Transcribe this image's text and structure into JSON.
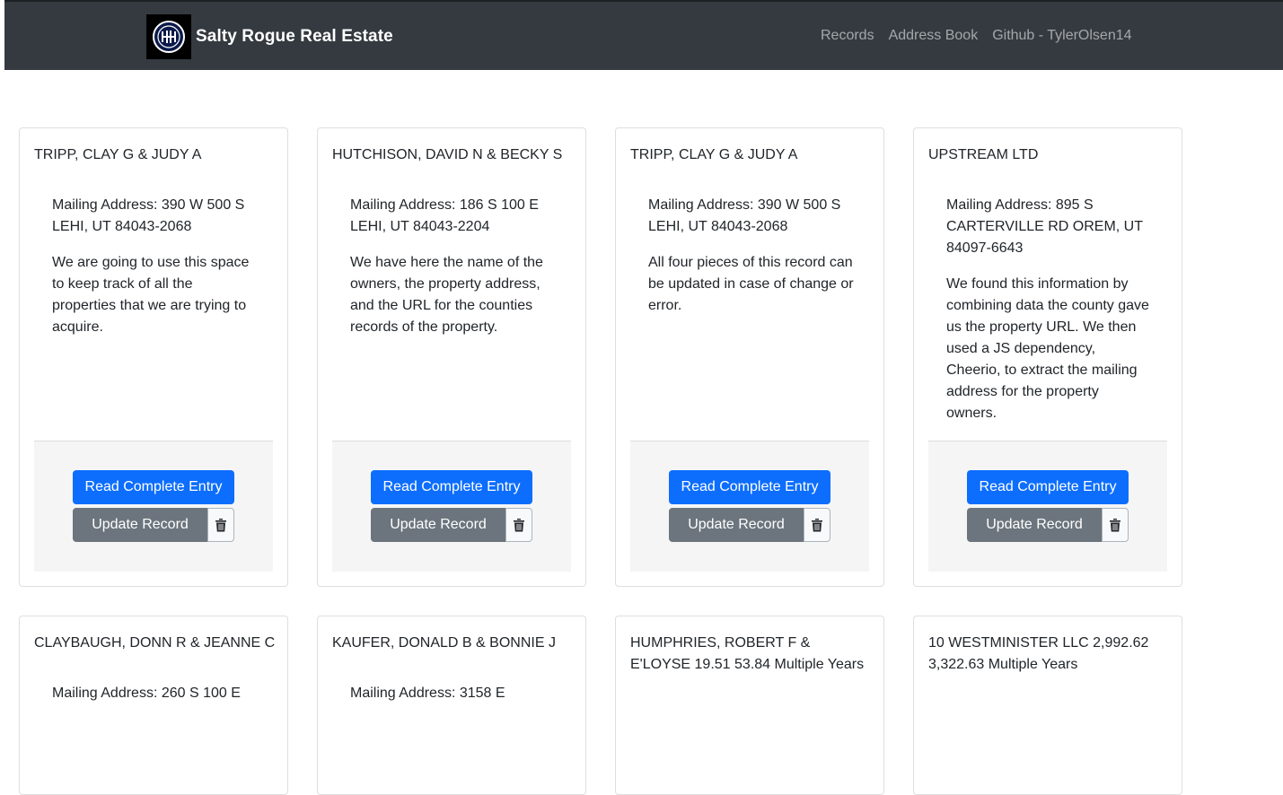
{
  "navbar": {
    "brand": "Salty Rogue Real Estate",
    "links": [
      "Records",
      "Address Book",
      "Github - TylerOlsen14"
    ]
  },
  "buttons": {
    "read": "Read Complete Entry",
    "update": "Update Record",
    "delete_icon": "trash-icon"
  },
  "records": [
    {
      "owner": "TRIPP, CLAY G & JUDY A",
      "mailing": "Mailing Address: 390 W 500 S LEHI, UT 84043-2068",
      "notes": "We are going to use this space to keep track of all the properties that we are trying to acquire."
    },
    {
      "owner": "HUTCHISON, DAVID N & BECKY S",
      "mailing": "Mailing Address: 186 S 100 E LEHI, UT 84043-2204",
      "notes": "We have here the name of the owners, the property address, and the URL for the counties records of the property."
    },
    {
      "owner": "TRIPP, CLAY G & JUDY A",
      "mailing": "Mailing Address: 390 W 500 S LEHI, UT 84043-2068",
      "notes": "All four pieces of this record can be updated in case of change or error."
    },
    {
      "owner": "UPSTREAM LTD",
      "mailing": "Mailing Address: 895 S CARTERVILLE RD OREM, UT 84097-6643",
      "notes": "We found this information by combining data the county gave us the property URL. We then used a JS dependency, Cheerio, to extract the mailing address for the property owners."
    },
    {
      "owner": "CLAYBAUGH, DONN R & JEANNE C",
      "mailing": "Mailing Address: 260 S 100 E",
      "notes": ""
    },
    {
      "owner": "KAUFER, DONALD B & BONNIE J",
      "mailing": "Mailing Address: 3158 E",
      "notes": ""
    },
    {
      "owner": "HUMPHRIES, ROBERT F & E'LOYSE 19.51 53.84 Multiple Years",
      "mailing": "",
      "notes": ""
    },
    {
      "owner": "10 WESTMINISTER LLC 2,992.62 3,322.63 Multiple Years",
      "mailing": "",
      "notes": ""
    }
  ]
}
